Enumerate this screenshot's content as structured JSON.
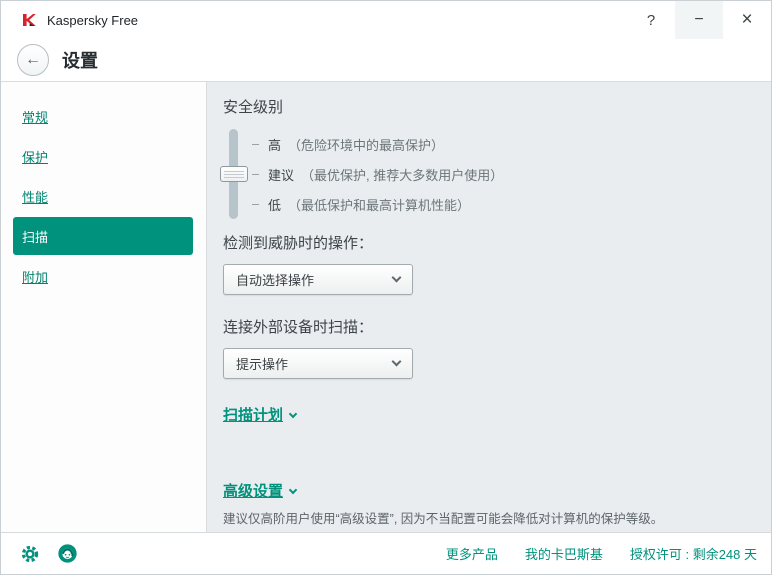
{
  "window": {
    "title": "Kaspersky Free"
  },
  "titlebar": {
    "help": "?",
    "minimize": "−",
    "close": "×"
  },
  "header": {
    "back": "←",
    "title": "设置"
  },
  "sidebar": {
    "items": [
      {
        "label": "常规",
        "active": false
      },
      {
        "label": "保护",
        "active": false
      },
      {
        "label": "性能",
        "active": false
      },
      {
        "label": "扫描",
        "active": true
      },
      {
        "label": "附加",
        "active": false
      }
    ]
  },
  "main": {
    "security": {
      "title": "安全级别",
      "selected_level": "建议",
      "levels": [
        {
          "name": "高",
          "desc": "（危险环境中的最高保护）"
        },
        {
          "name": "建议",
          "desc": "（最优保护, 推荐大多数用户使用）"
        },
        {
          "name": "低",
          "desc": "（最低保护和最高计算机性能）"
        }
      ]
    },
    "threat_action": {
      "label": "检测到威胁时的操作：",
      "value": "自动选择操作"
    },
    "external_scan": {
      "label": "连接外部设备时扫描：",
      "value": "提示操作"
    },
    "scan_schedule": {
      "label": "扫描计划"
    },
    "advanced": {
      "label": "高级设置",
      "note": "建议仅高阶用户使用“高级设置”, 因为不当配置可能会降低对计算机的保护等级。"
    }
  },
  "footer": {
    "more_products": "更多产品",
    "my_kaspersky": "我的卡巴斯基",
    "license": "授权许可 : 剩余248 天"
  },
  "colors": {
    "brand_green": "#00927C",
    "link_green": "#00836E",
    "content_bg": "#E9EDEF",
    "logo_red": "#D7232B"
  }
}
